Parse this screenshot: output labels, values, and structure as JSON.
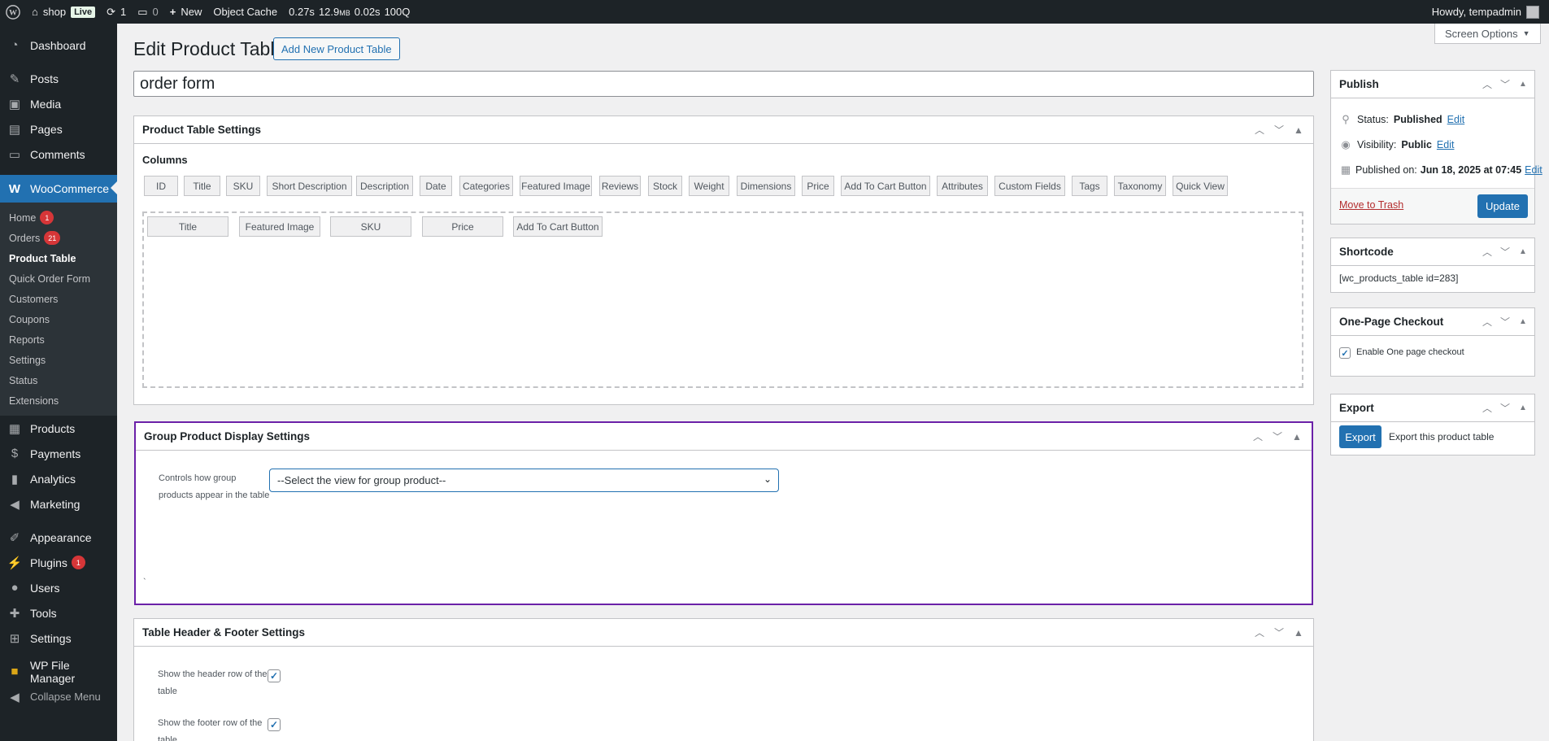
{
  "admin_bar": {
    "site_name": "shop",
    "live_badge": "Live",
    "updates_count": "1",
    "comments_count": "0",
    "new_label": "New",
    "object_cache": "Object Cache",
    "time_stat": "0.27s",
    "memory_value": "12.9",
    "memory_unit": "MB",
    "db_time": "0.02s",
    "query_count": "100Q",
    "howdy": "Howdy, tempadmin"
  },
  "sidebar": {
    "dashboard": "Dashboard",
    "posts": "Posts",
    "media": "Media",
    "pages": "Pages",
    "comments": "Comments",
    "woocommerce": "WooCommerce",
    "woo_submenu": [
      {
        "label": "Home",
        "badge": "1"
      },
      {
        "label": "Orders",
        "badge": "21"
      },
      {
        "label": "Product Table",
        "badge": ""
      },
      {
        "label": "Quick Order Form",
        "badge": ""
      },
      {
        "label": "Customers",
        "badge": ""
      },
      {
        "label": "Coupons",
        "badge": ""
      },
      {
        "label": "Reports",
        "badge": ""
      },
      {
        "label": "Settings",
        "badge": ""
      },
      {
        "label": "Status",
        "badge": ""
      },
      {
        "label": "Extensions",
        "badge": ""
      }
    ],
    "products": "Products",
    "payments": "Payments",
    "analytics": "Analytics",
    "marketing": "Marketing",
    "appearance": "Appearance",
    "plugins": "Plugins",
    "plugins_badge": "1",
    "users": "Users",
    "tools": "Tools",
    "settings": "Settings",
    "wp_file_manager": "WP File Manager",
    "collapse_menu": "Collapse Menu"
  },
  "header": {
    "page_title": "Edit Product Table",
    "add_new_button": "Add New Product Table",
    "screen_options": "Screen Options"
  },
  "title_field": {
    "value": "order form"
  },
  "product_table_settings": {
    "title": "Product Table Settings",
    "columns_label": "Columns",
    "available_columns": [
      "ID",
      "Title",
      "SKU",
      "Short Description",
      "Description",
      "Date",
      "Categories",
      "Featured Image",
      "Reviews",
      "Stock",
      "Weight",
      "Dimensions",
      "Price",
      "Add To Cart Button",
      "Attributes",
      "Custom Fields",
      "Tags",
      "Taxonomy",
      "Quick View"
    ],
    "selected_columns": [
      "Title",
      "Featured Image",
      "SKU",
      "Price",
      "Add To Cart Button"
    ]
  },
  "group_product": {
    "title": "Group Product Display Settings",
    "label_line1": "Controls how group",
    "label_line2": "products appear in the table",
    "select_value": "--Select the view for group product--",
    "stray_char": "`"
  },
  "header_footer": {
    "title": "Table Header & Footer Settings",
    "header_label_line1": "Show the header row of the",
    "header_label_line2": "table",
    "footer_label_line1": "Show the footer row of the",
    "footer_label_line2": "table",
    "header_checked": true,
    "footer_checked": true
  },
  "publish": {
    "title": "Publish",
    "status_label": "Status:",
    "status_value": "Published",
    "visibility_label": "Visibility:",
    "visibility_value": "Public",
    "published_on_label": "Published on:",
    "published_on_value": "Jun 18, 2025 at 07:45",
    "edit_link": "Edit",
    "trash_link": "Move to Trash",
    "update_button": "Update"
  },
  "shortcode": {
    "title": "Shortcode",
    "value": "[wc_products_table id=283]"
  },
  "one_page_checkout": {
    "title": "One-Page Checkout",
    "label": "Enable One page checkout",
    "checked": true
  },
  "export": {
    "title": "Export",
    "button": "Export",
    "description": "Export this product table"
  },
  "colors": {
    "admin_dark": "#1d2327",
    "accent": "#2271b1",
    "badge_red": "#d63638",
    "focus_purple": "#6b21a8"
  }
}
